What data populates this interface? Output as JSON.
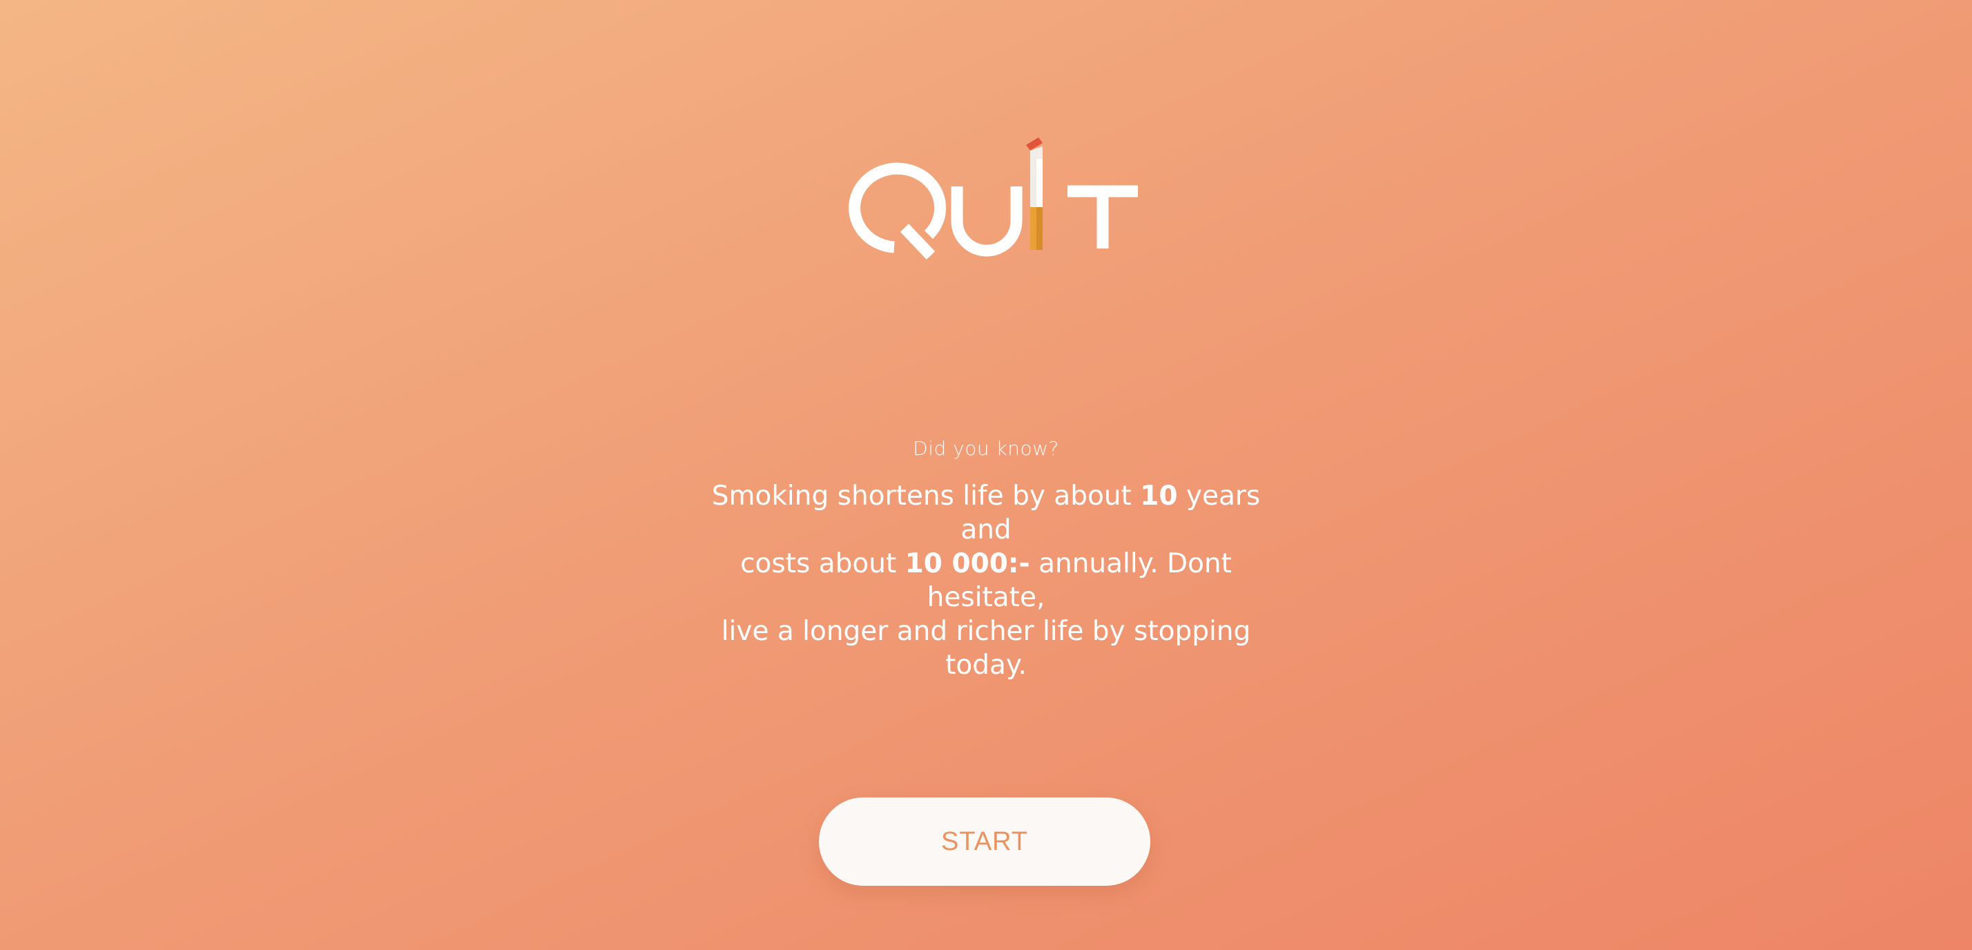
{
  "logo": {
    "wordmark": "QUIT",
    "icon": "cigarette-icon"
  },
  "fact": {
    "eyebrow": "Did you know?",
    "line1_a": "Smoking shortens life by about ",
    "line1_b": "10",
    "line1_c": " years and",
    "line2_a": "costs about ",
    "line2_b": "10 000:-",
    "line2_c": " annually. Dont hesitate,",
    "line3": "live a longer and richer life by stopping today."
  },
  "start_button": {
    "label": "START"
  },
  "colors": {
    "background_start": "#f4b685",
    "background_end": "#ed8566",
    "button_background": "#fbf8f6",
    "button_text": "#eb925f",
    "cigarette_filter": "#e8a037",
    "cigarette_ember": "#e2553b"
  }
}
